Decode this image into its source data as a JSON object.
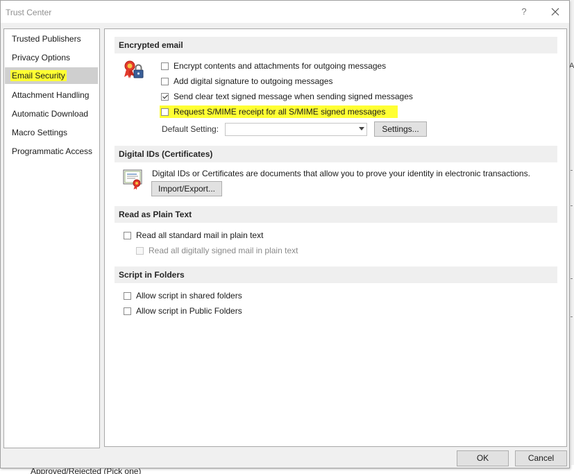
{
  "window": {
    "title": "Trust Center",
    "help_label": "?",
    "close_label": "×"
  },
  "nav": {
    "items": [
      {
        "label": "Trusted Publishers"
      },
      {
        "label": "Privacy Options"
      },
      {
        "label": "Email Security",
        "selected": true
      },
      {
        "label": "Attachment Handling"
      },
      {
        "label": "Automatic Download"
      },
      {
        "label": "Macro Settings"
      },
      {
        "label": "Programmatic Access"
      }
    ]
  },
  "encrypted_email": {
    "header": "Encrypted email",
    "options": [
      {
        "label": "Encrypt contents and attachments for outgoing messages",
        "checked": false
      },
      {
        "label": "Add digital signature to outgoing messages",
        "checked": false
      },
      {
        "label": "Send clear text signed message when sending signed messages",
        "checked": true
      },
      {
        "label": "Request S/MIME receipt for all S/MIME signed messages",
        "checked": false,
        "highlighted": true
      }
    ],
    "default_setting_label": "Default Setting:",
    "default_setting_value": "",
    "settings_button": "Settings..."
  },
  "digital_ids": {
    "header": "Digital IDs (Certificates)",
    "description": "Digital IDs or Certificates are documents that allow you to prove your identity in electronic transactions.",
    "import_export_button": "Import/Export..."
  },
  "plain_text": {
    "header": "Read as Plain Text",
    "options": [
      {
        "label": "Read all standard mail in plain text",
        "checked": false,
        "enabled": true
      },
      {
        "label": "Read all digitally signed mail in plain text",
        "checked": false,
        "enabled": false
      }
    ]
  },
  "script_folders": {
    "header": "Script in Folders",
    "options": [
      {
        "label": "Allow script in shared folders",
        "checked": false
      },
      {
        "label": "Allow script in Public Folders",
        "checked": false
      }
    ]
  },
  "footer": {
    "ok": "OK",
    "cancel": "Cancel"
  },
  "background_text": "Approved/Rejected (Pick one)",
  "colors": {
    "highlight": "#ffff33",
    "selected_nav": "#cfcfcf",
    "section_header": "#efefef"
  }
}
